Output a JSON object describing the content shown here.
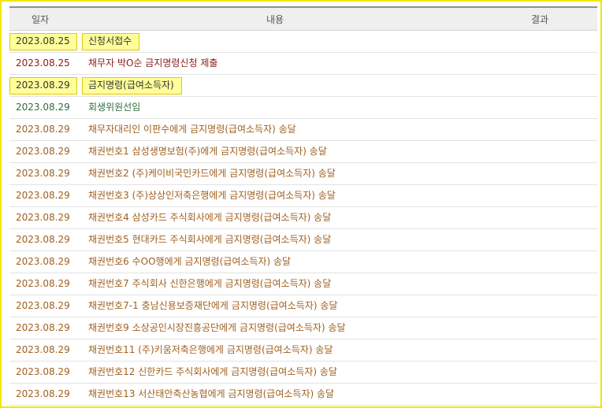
{
  "header": {
    "date": "일자",
    "content": "내용",
    "result": "결과"
  },
  "rows": [
    {
      "date": "2023.08.25",
      "text": "신청서접수",
      "highlight": true,
      "color": "dark"
    },
    {
      "date": "2023.08.25",
      "text": "채무자 박O순 금지명령신청 제출",
      "highlight": false,
      "color": "red"
    },
    {
      "date": "2023.08.29",
      "text": "금지명령(급여소득자)",
      "highlight": true,
      "color": "dark"
    },
    {
      "date": "2023.08.29",
      "text": "회생위원선임",
      "highlight": false,
      "color": "green"
    },
    {
      "date": "2023.08.29",
      "text": "채무자대리인 이판수에게 금지명령(급여소득자) 송달",
      "highlight": false,
      "color": "orange"
    },
    {
      "date": "2023.08.29",
      "text": "채권번호1 삼성생명보험(주)에게 금지명령(급여소득자) 송달",
      "highlight": false,
      "color": "orange"
    },
    {
      "date": "2023.08.29",
      "text": "채권번호2 (주)케이비국민카드에게 금지명령(급여소득자) 송달",
      "highlight": false,
      "color": "orange"
    },
    {
      "date": "2023.08.29",
      "text": "채권번호3 (주)상상인저축은행에게 금지명령(급여소득자) 송달",
      "highlight": false,
      "color": "orange"
    },
    {
      "date": "2023.08.29",
      "text": "채권번호4 삼성카드 주식회사에게 금지명령(급여소득자) 송달",
      "highlight": false,
      "color": "orange"
    },
    {
      "date": "2023.08.29",
      "text": "채권번호5 현대카드 주식회사에게 금지명령(급여소득자) 송달",
      "highlight": false,
      "color": "orange"
    },
    {
      "date": "2023.08.29",
      "text": "채권번호6 수OO행에게 금지명령(급여소득자) 송달",
      "highlight": false,
      "color": "orange"
    },
    {
      "date": "2023.08.29",
      "text": "채권번호7 주식회사 신한은행에게 금지명령(급여소득자) 송달",
      "highlight": false,
      "color": "orange"
    },
    {
      "date": "2023.08.29",
      "text": "채권번호7-1 충남신용보증재단에게 금지명령(급여소득자) 송달",
      "highlight": false,
      "color": "orange"
    },
    {
      "date": "2023.08.29",
      "text": "채권번호9 소상공인시장진흥공단에게 금지명령(급여소득자) 송달",
      "highlight": false,
      "color": "orange"
    },
    {
      "date": "2023.08.29",
      "text": "채권번호11 (주)키움저축은행에게 금지명령(급여소득자) 송달",
      "highlight": false,
      "color": "orange"
    },
    {
      "date": "2023.08.29",
      "text": "채권번호12 신한카드 주식회사에게 금지명령(급여소득자) 송달",
      "highlight": false,
      "color": "orange"
    },
    {
      "date": "2023.08.29",
      "text": "채권번호13 서산태안축산농협에게 금지명령(급여소득자) 송달",
      "highlight": false,
      "color": "orange"
    }
  ],
  "colors": {
    "dark": "#333333",
    "red": "#8b1a1a",
    "green": "#2f6b3c",
    "orange": "#a06020",
    "highlight_bg": "#ffff9a",
    "frame_border": "#f5e600"
  }
}
